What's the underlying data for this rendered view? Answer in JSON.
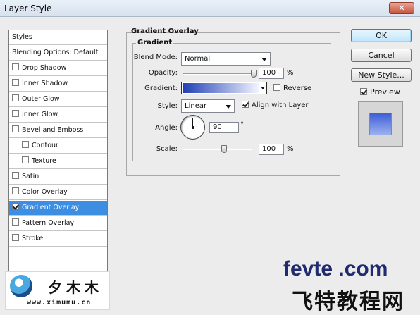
{
  "window": {
    "title": "Layer Style",
    "close_glyph": "✕"
  },
  "styles_list": {
    "header": "Styles",
    "blending": "Blending Options: Default",
    "items": [
      {
        "label": "Drop Shadow",
        "checked": false
      },
      {
        "label": "Inner Shadow",
        "checked": false
      },
      {
        "label": "Outer Glow",
        "checked": false
      },
      {
        "label": "Inner Glow",
        "checked": false
      },
      {
        "label": "Bevel and Emboss",
        "checked": false
      },
      {
        "label": "Contour",
        "checked": false
      },
      {
        "label": "Texture",
        "checked": false
      },
      {
        "label": "Satin",
        "checked": false
      },
      {
        "label": "Color Overlay",
        "checked": false
      },
      {
        "label": "Gradient Overlay",
        "checked": true,
        "selected": true
      },
      {
        "label": "Pattern Overlay",
        "checked": false
      },
      {
        "label": "Stroke",
        "checked": false
      }
    ]
  },
  "panel": {
    "title": "Gradient Overlay",
    "group": "Gradient",
    "blend_mode": {
      "label": "Blend Mode:",
      "value": "Normal"
    },
    "opacity": {
      "label": "Opacity:",
      "value": "100",
      "unit": "%",
      "level": 1.0
    },
    "gradient": {
      "label": "Gradient:",
      "from": "#1e3fb4",
      "to": "#f2f4ff"
    },
    "reverse": {
      "label": "Reverse",
      "checked": false
    },
    "style": {
      "label": "Style:",
      "value": "Linear"
    },
    "align": {
      "label": "Align with Layer",
      "checked": true
    },
    "angle": {
      "label": "Angle:",
      "value": "90",
      "unit": "°"
    },
    "scale": {
      "label": "Scale:",
      "value": "100",
      "unit": "%",
      "level": 0.6
    }
  },
  "buttons": {
    "ok": "OK",
    "cancel": "Cancel",
    "new_style": "New Style..."
  },
  "preview": {
    "label": "Preview",
    "checked": true,
    "from": "#3e5fd6",
    "to": "#9bb0f0"
  },
  "watermark": {
    "brand_cn": "夕木木",
    "brand_url": "www.ximumu.cn",
    "site_en": "fevte .com",
    "site_cn": "飞特教程网"
  }
}
